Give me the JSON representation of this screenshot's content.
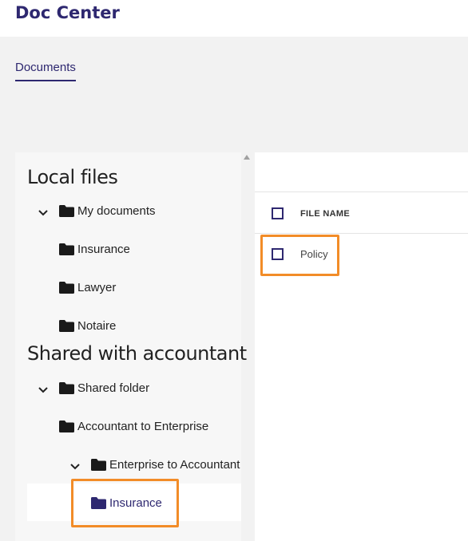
{
  "app": {
    "title": "Doc Center"
  },
  "tabs": [
    {
      "label": "Documents",
      "active": true
    }
  ],
  "tree": {
    "local_section": "Local files",
    "shared_section": "Shared with accountant",
    "nodes": {
      "my_documents": "My documents",
      "insurance": "Insurance",
      "lawyer": "Lawyer",
      "notaire": "Notaire",
      "shared_folder": "Shared folder",
      "accountant_to_enterprise": "Accountant to Enterprise",
      "enterprise_to_accountant": "Enterprise to Accountant",
      "shared_insurance": "Insurance"
    },
    "selected": "shared_insurance"
  },
  "files": {
    "column_header": "FILE NAME",
    "rows": [
      {
        "name": "Policy",
        "checked": false
      }
    ]
  },
  "colors": {
    "brand": "#2e2870",
    "highlight": "#f28c28",
    "folder_default": "#1a1a1a",
    "folder_selected": "#2e2870"
  },
  "icons": {
    "folder": "folder-icon",
    "expand": "chevron-down-icon",
    "scroll_up": "scroll-up-arrow-icon"
  }
}
